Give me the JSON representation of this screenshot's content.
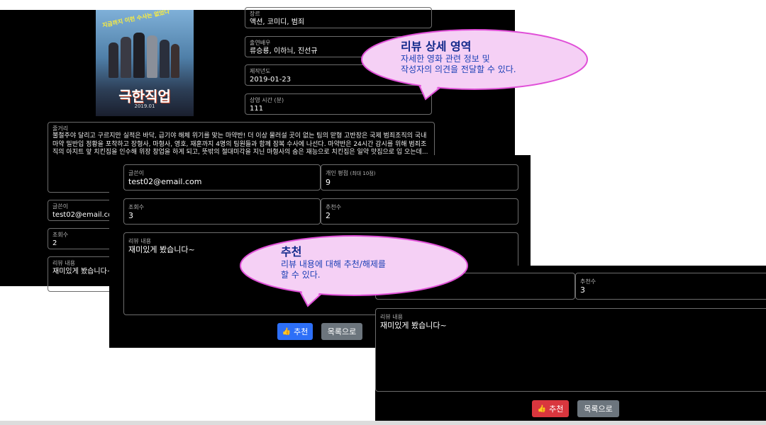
{
  "back": {
    "genre": {
      "label": "장르",
      "value": "액션, 코미디, 범죄"
    },
    "cast": {
      "label": "출연배우",
      "value": "류승룡, 이하늬, 진선규"
    },
    "year": {
      "label": "제작년도",
      "value": "2019-01-23"
    },
    "runtime": {
      "label": "상영 시간 (분)",
      "value": "111"
    },
    "plot": {
      "label": "줄거리",
      "value": "불철주야 달리고 구르지만 실적은 바닥, 급기야 해체 위기를 맞는 마약반!  더 이상 물러설 곳이 없는 팀의 맏형 고반장은 국제 범죄조직의 국내 마약 밀반입 정황을 포착하고 장형사, 마형사, 영호, 재훈까지 4명의 팀원들과 함께 잠복 수사에 나선다.  마약반은 24시간 감시를 위해 범죄조직의 아지트 앞 치킨집을 인수해 위장 창업을 하게 되고, 뜻밖의 절대미각을 지닌 마형사의 숨은 재능으로 치킨집은 일약 맛집으로 입 오는데..."
    },
    "writer": {
      "label": "글쓴이",
      "value": "test02@email.com"
    },
    "views": {
      "label": "조회수",
      "value": "2"
    },
    "review": {
      "label": "리뷰 내용",
      "value": "재미있게 봤습니다~"
    },
    "poster": {
      "text_small": "지금까지 이런 수사는 없었다",
      "title": "극한직업",
      "date": "2019.01"
    }
  },
  "middle": {
    "writer": {
      "label": "글쓴이",
      "value": "test02@email.com"
    },
    "rating": {
      "label": "개인 평점",
      "hint": "(최대 10점)",
      "value": "9"
    },
    "views": {
      "label": "조회수",
      "value": "3"
    },
    "recommend": {
      "label": "추천수",
      "value": "2"
    },
    "review": {
      "label": "리뷰 내용",
      "value": "재미있게 봤습니다~"
    },
    "recommend_btn": "추천",
    "list_btn": "목록으로"
  },
  "front": {
    "recommend": {
      "label": "추천수",
      "value": "3"
    },
    "review": {
      "label": "리뷰 내용",
      "value": "재미있게 봤습니다~"
    },
    "recommend_btn": "추천",
    "list_btn": "목록으로"
  },
  "callouts": {
    "detail": {
      "title": "리뷰 상세 영역",
      "line1": "자세한 영화 관련 정보 및",
      "line2": "작성자의 의견을 전달할 수 있다."
    },
    "recommend": {
      "title": "추천",
      "line1": "리뷰 내용에 대해 추천/해제를",
      "line2": "할 수 있다."
    }
  },
  "colors": {
    "panel_bg": "#000000",
    "border": "#6c6c6c",
    "recommend_btn": "#2d6ff7",
    "recommend_active": "#d9363e",
    "list_btn": "#6c757d",
    "callout_fill": "#f5d0f5",
    "callout_border": "#e04fd8",
    "callout_text": "#1a3fb5"
  }
}
